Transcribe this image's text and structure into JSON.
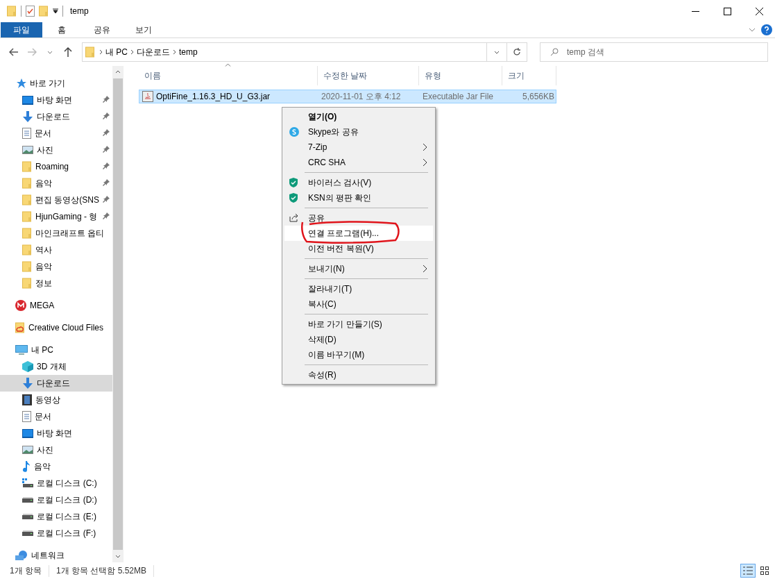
{
  "window": {
    "title": "temp"
  },
  "ribbon": {
    "tabs": [
      {
        "label": "파일",
        "selected": true
      },
      {
        "label": "홈",
        "selected": false
      },
      {
        "label": "공유",
        "selected": false
      },
      {
        "label": "보기",
        "selected": false
      }
    ]
  },
  "address": {
    "crumbs": [
      "내 PC",
      "다운로드",
      "temp"
    ],
    "search_placeholder": "temp 검색"
  },
  "sidebar": {
    "groups": [
      {
        "label": "바로 가기",
        "kind": "star",
        "selected": false,
        "children": [
          {
            "label": "바탕 화면",
            "kind": "desktop",
            "pinned": true,
            "selected": false
          },
          {
            "label": "다운로드",
            "kind": "download",
            "pinned": true,
            "selected": false
          },
          {
            "label": "문서",
            "kind": "document",
            "pinned": true,
            "selected": false
          },
          {
            "label": "사진",
            "kind": "pictures",
            "pinned": true,
            "selected": false
          },
          {
            "label": "Roaming",
            "kind": "folder",
            "pinned": true,
            "selected": false
          },
          {
            "label": "음악",
            "kind": "folder",
            "pinned": true,
            "selected": false
          },
          {
            "label": "편집 동영상(SNS",
            "kind": "folder",
            "pinned": true,
            "selected": false
          },
          {
            "label": "HjunGaming - 형",
            "kind": "folder",
            "pinned": true,
            "selected": false
          },
          {
            "label": "마인크래프트 옵티",
            "kind": "folder",
            "pinned": false,
            "selected": false
          },
          {
            "label": "역사",
            "kind": "folder",
            "pinned": false,
            "selected": false
          },
          {
            "label": "음악",
            "kind": "folder",
            "pinned": false,
            "selected": false
          },
          {
            "label": "정보",
            "kind": "folder",
            "pinned": false,
            "selected": false
          }
        ]
      },
      {
        "label": "MEGA",
        "kind": "mega",
        "selected": false
      },
      {
        "label": "Creative Cloud Files",
        "kind": "cloud",
        "selected": false
      },
      {
        "label": "내 PC",
        "kind": "pc",
        "selected": false,
        "children": [
          {
            "label": "3D 개체",
            "kind": "cube",
            "pinned": false,
            "selected": false
          },
          {
            "label": "다운로드",
            "kind": "download",
            "pinned": false,
            "selected": true
          },
          {
            "label": "동영상",
            "kind": "video",
            "pinned": false,
            "selected": false
          },
          {
            "label": "문서",
            "kind": "document",
            "pinned": false,
            "selected": false
          },
          {
            "label": "바탕 화면",
            "kind": "desktop",
            "pinned": false,
            "selected": false
          },
          {
            "label": "사진",
            "kind": "pictures",
            "pinned": false,
            "selected": false
          },
          {
            "label": "음악",
            "kind": "music",
            "pinned": false,
            "selected": false
          },
          {
            "label": "로컬 디스크 (C:)",
            "kind": "drive-win",
            "pinned": false,
            "selected": false
          },
          {
            "label": "로컬 디스크 (D:)",
            "kind": "drive",
            "pinned": false,
            "selected": false
          },
          {
            "label": "로컬 디스크 (E:)",
            "kind": "drive",
            "pinned": false,
            "selected": false
          },
          {
            "label": "로컬 디스크 (F:)",
            "kind": "drive",
            "pinned": false,
            "selected": false
          }
        ]
      },
      {
        "label": "네트워크",
        "kind": "network",
        "selected": false
      }
    ]
  },
  "table": {
    "columns": [
      {
        "label": "이름",
        "sorted": true
      },
      {
        "label": "수정한 날짜",
        "sorted": false
      },
      {
        "label": "유형",
        "sorted": false
      },
      {
        "label": "크기",
        "sorted": false
      }
    ],
    "rows": [
      {
        "name": "OptiFine_1.16.3_HD_U_G3.jar",
        "date": "2020-11-01 오후 4:12",
        "type": "Executable Jar File",
        "size": "5,656KB",
        "selected": true
      }
    ]
  },
  "context_menu": {
    "items": [
      {
        "kind": "command",
        "label": "열기(O)",
        "default": true,
        "selected": false
      },
      {
        "kind": "skype",
        "label": "Skype와 공유",
        "selected": false
      },
      {
        "kind": "command",
        "label": "7-Zip",
        "submenu": true,
        "selected": false
      },
      {
        "kind": "command",
        "label": "CRC SHA",
        "submenu": true,
        "selected": false
      },
      {
        "kind": "separator"
      },
      {
        "kind": "shield",
        "label": "바이러스 검사(V)",
        "selected": false
      },
      {
        "kind": "shield",
        "label": "KSN의 평판 확인",
        "selected": false
      },
      {
        "kind": "separator"
      },
      {
        "kind": "share",
        "label": "공유",
        "selected": false
      },
      {
        "kind": "command",
        "label": "연결 프로그램(H)...",
        "selected": true,
        "annotated": true
      },
      {
        "kind": "command",
        "label": "이전 버전 복원(V)",
        "selected": false
      },
      {
        "kind": "separator"
      },
      {
        "kind": "command",
        "label": "보내기(N)",
        "submenu": true,
        "selected": false
      },
      {
        "kind": "separator"
      },
      {
        "kind": "command",
        "label": "잘라내기(T)",
        "selected": false
      },
      {
        "kind": "command",
        "label": "복사(C)",
        "selected": false
      },
      {
        "kind": "separator"
      },
      {
        "kind": "command",
        "label": "바로 가기 만들기(S)",
        "selected": false
      },
      {
        "kind": "command",
        "label": "삭제(D)",
        "selected": false
      },
      {
        "kind": "command",
        "label": "이름 바꾸기(M)",
        "selected": false
      },
      {
        "kind": "separator"
      },
      {
        "kind": "command",
        "label": "속성(R)",
        "selected": false
      }
    ]
  },
  "status_bar": {
    "items": [
      "1개 항목",
      "1개 항목 선택함 5.52MB"
    ]
  }
}
